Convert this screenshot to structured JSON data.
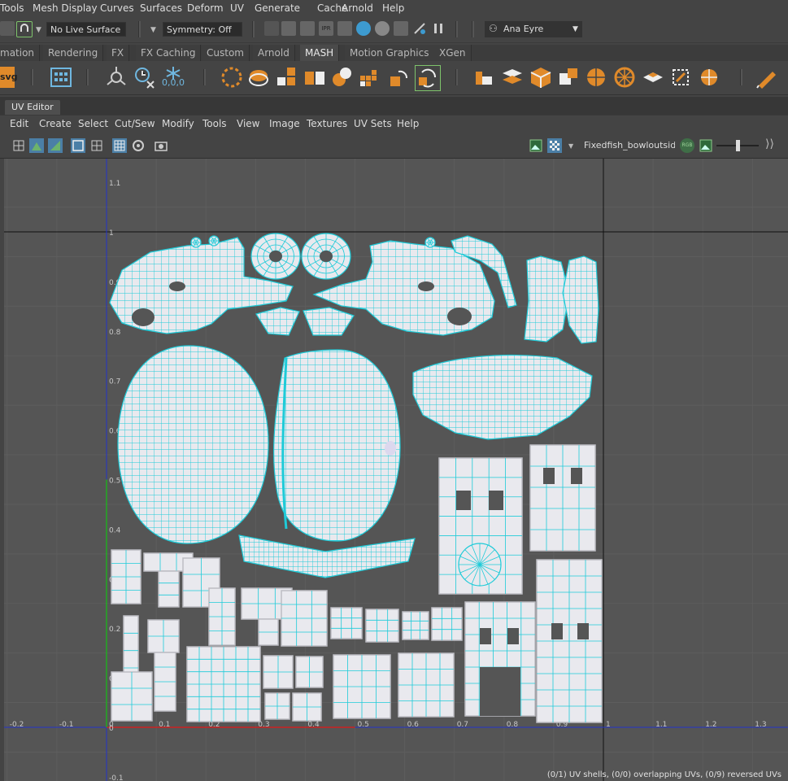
{
  "main_menu": [
    "Tools",
    "Mesh Display",
    "Curves",
    "Surfaces",
    "Deform",
    "UV",
    "Generate",
    "Cache",
    "Arnold",
    "Help"
  ],
  "status_line": {
    "live_surface": "No Live Surface",
    "symmetry": "Symmetry: Off",
    "user": "Ana Eyre"
  },
  "shelf_tabs": [
    "mation",
    "Rendering",
    "FX",
    "FX Caching",
    "Custom",
    "Arnold",
    "MASH",
    "Motion Graphics",
    "XGen"
  ],
  "shelf_active": "MASH",
  "shelf": {
    "svg_label": "svg",
    "coords": "0,0,0"
  },
  "panel_tab": "UV Editor",
  "uv_menu": [
    "Edit",
    "Create",
    "Select",
    "Cut/Sew",
    "Modify",
    "Tools",
    "View",
    "Image",
    "Textures",
    "UV Sets",
    "Help"
  ],
  "uv_toolbar": {
    "texture_name": "Fixedfish_bowloutside",
    "rgb_label": "RGB"
  },
  "grid": {
    "u_labels": [
      "-0.2",
      "-0.1",
      "0",
      "0.1",
      "0.2",
      "0.3",
      "0.4",
      "0.5",
      "0.6",
      "0.7",
      "0.8",
      "0.9",
      "1",
      "1.1",
      "1.2",
      "1.3"
    ],
    "v_labels": [
      "1.1",
      "1",
      "0.9",
      "0.8",
      "0.7",
      "0.6",
      "0.5",
      "0.4",
      "0.3",
      "0.2",
      "0.1",
      "0",
      "-0.1"
    ]
  },
  "status_text": "(0/1) UV shells, (0/0) overlapping UVs, (0/9) reversed UVs",
  "colors": {
    "uv_edge": "#1ecbd8",
    "shell_fill": "#e9e9ee",
    "u_axis": "#cc2222",
    "v_axis": "#22aa22",
    "origin_axis": "#2233cc"
  }
}
